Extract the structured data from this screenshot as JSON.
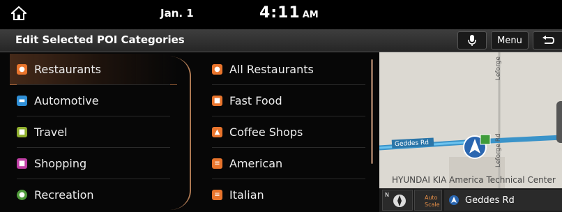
{
  "status_bar": {
    "date": "Jan. 1",
    "time": "4:11",
    "ampm": "AM"
  },
  "title_bar": {
    "title": "Edit Selected POI Categories",
    "menu_label": "Menu"
  },
  "categories": [
    {
      "label": "Restaurants",
      "icon": "restaurant-icon",
      "color": "#e8742c",
      "selected": true
    },
    {
      "label": "Automotive",
      "icon": "car-icon",
      "color": "#2f8fd6"
    },
    {
      "label": "Travel",
      "icon": "luggage-icon",
      "color": "#8fae2e"
    },
    {
      "label": "Shopping",
      "icon": "gift-icon",
      "color": "#c03fa5"
    },
    {
      "label": "Recreation",
      "icon": "recreation-icon",
      "color": "#4f9a3a"
    }
  ],
  "subcategories": [
    {
      "label": "All Restaurants",
      "icon": "restaurant-icon",
      "color": "#e8742c"
    },
    {
      "label": "Fast Food",
      "icon": "fast-food-icon",
      "color": "#e8742c"
    },
    {
      "label": "Coffee Shops",
      "icon": "coffee-icon",
      "color": "#e8742c"
    },
    {
      "label": "American",
      "icon": "american-food-icon",
      "color": "#e8742c"
    },
    {
      "label": "Italian",
      "icon": "italian-food-icon",
      "color": "#e8742c"
    }
  ],
  "map": {
    "street_label_1": "Geddes Rd",
    "street_label_2": "Leforge Rd",
    "street_label_3": "Leforge",
    "place_label": "HYUNDAI KIA America Technical Center",
    "compass_label": "N",
    "autoscale_label_1": "Auto",
    "autoscale_label_2": "Scale",
    "current_road": "Geddes Rd"
  }
}
